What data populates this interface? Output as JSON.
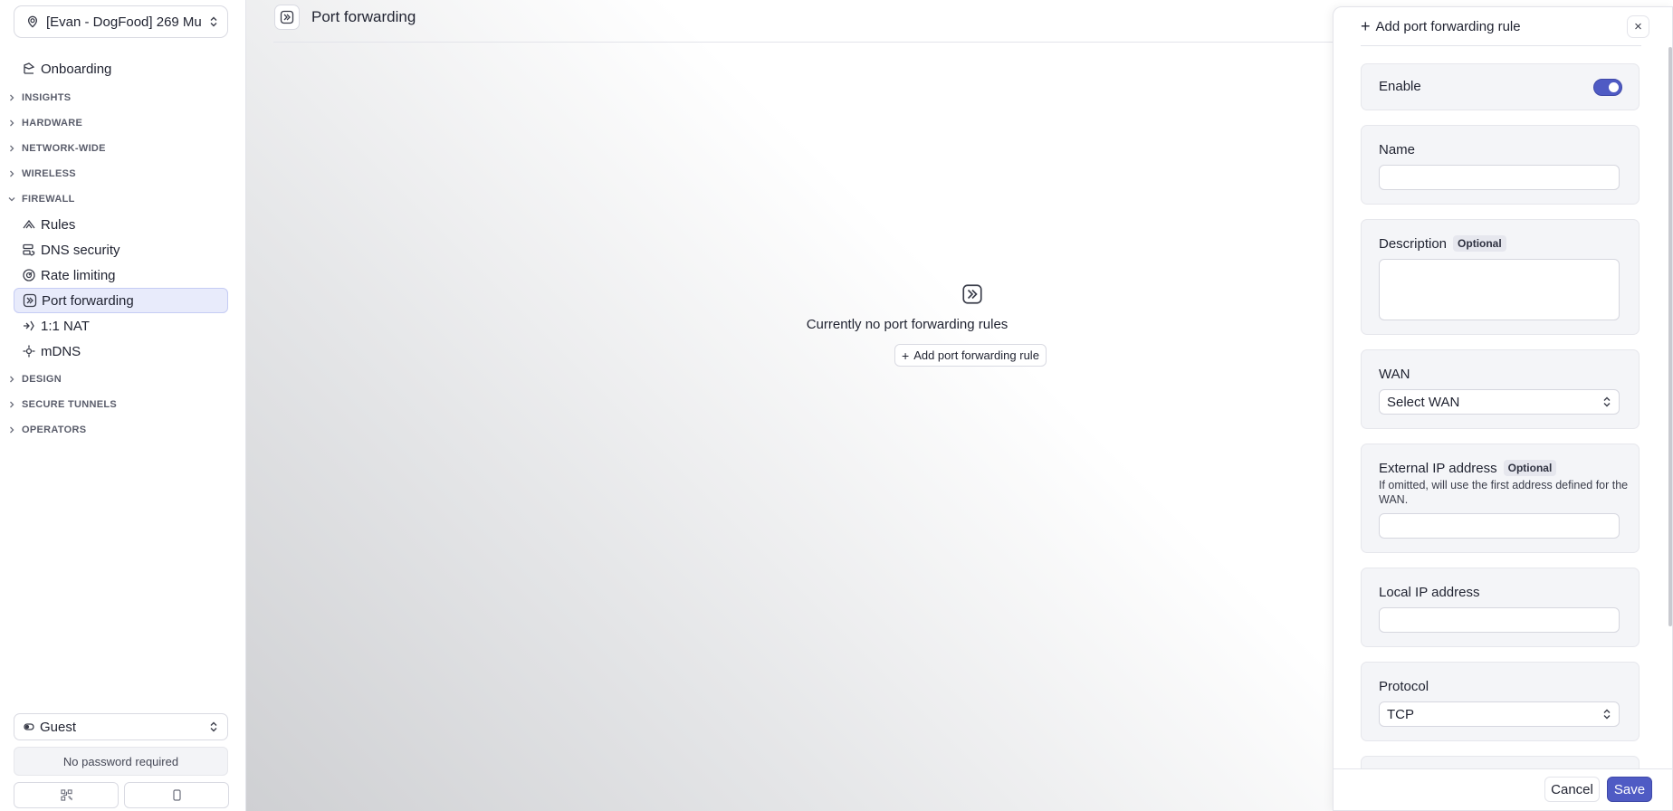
{
  "sidebar": {
    "org_selector": "[Evan - DogFood] 269 Mu",
    "onboarding": "Onboarding",
    "sections": {
      "insights": "INSIGHTS",
      "hardware": "HARDWARE",
      "network_wide": "NETWORK-WIDE",
      "wireless": "WIRELESS",
      "firewall": "FIREWALL",
      "design": "DESIGN",
      "secure_tunnels": "SECURE TUNNELS",
      "operators": "OPERATORS"
    },
    "firewall_items": {
      "rules": "Rules",
      "dns_security": "DNS security",
      "rate_limiting": "Rate limiting",
      "port_forwarding": "Port forwarding",
      "nat": "1:1 NAT",
      "mdns": "mDNS"
    },
    "ssid_selector": "Guest",
    "password_status": "No password required"
  },
  "header": {
    "title": "Port forwarding"
  },
  "empty_state": {
    "message": "Currently no port forwarding rules",
    "add_button": "Add port forwarding rule"
  },
  "drawer": {
    "title": "Add port forwarding rule",
    "close": "×",
    "enable_label": "Enable",
    "enabled": true,
    "name_label": "Name",
    "name_value": "",
    "description_label": "Description",
    "optional_tag": "Optional",
    "description_value": "",
    "wan_label": "WAN",
    "wan_value": "Select WAN",
    "external_ip_label": "External IP address",
    "external_ip_hint": "If omitted, will use the first address defined for the WAN.",
    "external_ip_value": "",
    "local_ip_label": "Local IP address",
    "local_ip_value": "",
    "protocol_label": "Protocol",
    "protocol_value": "TCP",
    "cancel_button": "Cancel",
    "save_button": "Save"
  },
  "colors": {
    "accent": "#4f5bc4",
    "active_nav_bg": "#e8ebfb"
  }
}
